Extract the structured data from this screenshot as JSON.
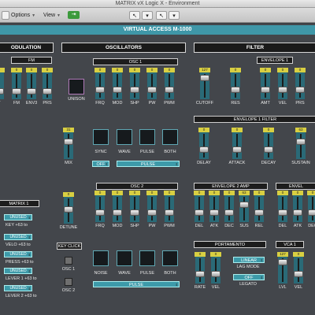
{
  "window": {
    "title": "MATRIX vX Logic X - Environment"
  },
  "toolbar": {
    "options": "Options",
    "view": "View",
    "green_icon": "green-midi-icon"
  },
  "header": {
    "title": "VIRTUAL ACCESS  M-1000"
  },
  "sections": {
    "modulation": "ODULATION",
    "oscillators": "OSCILLATORS",
    "filter": "FILTER"
  },
  "subsections": {
    "fm": "FM",
    "osc1": "OSC 1",
    "osc2": "OSC 2",
    "envelope1": "ENVELOPE 1",
    "envelope1_filter": "ENVELOPE 1 FILTER",
    "envelope2_amp": "ENVELOPE 2 AMP",
    "envelope_partial": "ENVEL",
    "portamento": "PORTAMENTO",
    "vca1": "VCA 1",
    "matrix1": "MATRIX 1",
    "key_click": "KEY CLICK"
  },
  "sliders": {
    "fm_t": {
      "label": "T",
      "value": "0"
    },
    "fm_fm": {
      "label": "FM",
      "value": "0"
    },
    "fm_env3": {
      "label": "ENV3",
      "value": "0"
    },
    "fm_prs": {
      "label": "PRS",
      "value": "0"
    },
    "osc1_frq": {
      "label": "FRQ",
      "value": "0"
    },
    "osc1_mod": {
      "label": "MOD",
      "value": "0"
    },
    "osc1_shp": {
      "label": "SHP",
      "value": "0"
    },
    "osc1_pw": {
      "label": "PW",
      "value": "0"
    },
    "osc1_pwm": {
      "label": "PWM",
      "value": "0"
    },
    "f_cutoff": {
      "label": "CUTOFF",
      "value": "127"
    },
    "f_res": {
      "label": "RES",
      "value": "0"
    },
    "f_amt": {
      "label": "AMT",
      "value": "0"
    },
    "f_vel": {
      "label": "VEL",
      "value": "0"
    },
    "f_prs": {
      "label": "PRS",
      "value": "0"
    },
    "mix": {
      "label": "MIX",
      "value": "31"
    },
    "e1_delay": {
      "label": "DELAY",
      "value": "0"
    },
    "e1_attack": {
      "label": "ATTACK",
      "value": "0"
    },
    "e1_decay": {
      "label": "DECAY",
      "value": "0"
    },
    "e1_sustain": {
      "label": "SUSTAIN",
      "value": "63"
    },
    "detune": {
      "label": "DETUNE",
      "value": "0"
    },
    "osc2_frq": {
      "label": "FRQ",
      "value": "0"
    },
    "osc2_mod": {
      "label": "MOD",
      "value": "0"
    },
    "osc2_shp": {
      "label": "SHP",
      "value": "0"
    },
    "osc2_pw": {
      "label": "PW",
      "value": "0"
    },
    "osc2_pwm": {
      "label": "PWM",
      "value": "0"
    },
    "e2_del": {
      "label": "DEL",
      "value": "0"
    },
    "e2_atk": {
      "label": "ATK",
      "value": "0"
    },
    "e2_dec": {
      "label": "DEC",
      "value": "0"
    },
    "e2_sus": {
      "label": "SUS",
      "value": "63"
    },
    "e2_rel": {
      "label": "REL",
      "value": "0"
    },
    "e3_del": {
      "label": "DEL",
      "value": "0"
    },
    "e3_atk": {
      "label": "ATK",
      "value": "0"
    },
    "e3_dec": {
      "label": "DEC",
      "value": "0"
    },
    "p_rate": {
      "label": "RATE",
      "value": "0"
    },
    "p_vel": {
      "label": "VEL",
      "value": "0"
    },
    "vca_lvl": {
      "label": "LVL",
      "value": "127"
    },
    "vca_vel": {
      "label": "VEL",
      "value": "0"
    }
  },
  "buttons": {
    "unison": "UNISON",
    "sync": "SYNC",
    "wave": "WAVE",
    "pulse": "PULSE",
    "both": "BOTH",
    "noise": "NOISE",
    "wave2": "WAVE",
    "pulse2": "PULSE",
    "both2": "BOTH",
    "osc1": "OSC 1",
    "osc2": "OSC 2"
  },
  "selects": {
    "sync_mode": "OFF",
    "osc1_wave": "PULSE",
    "osc2_wave": "PULSE",
    "lag_source": "LINEAR",
    "lag_mode_label": "LAG MODE",
    "legato_value": "OFF",
    "legato_label": "LEGATO"
  },
  "matrix": {
    "rows": [
      {
        "value": "UNUSED",
        "text": "KEY +63 to"
      },
      {
        "value": "UNUSED",
        "text": "VELO +63 to"
      },
      {
        "value": "UNUSED",
        "text": "PRESS +63 to"
      },
      {
        "value": "UNUSED",
        "text": "LEVER 1 +63 to"
      },
      {
        "value": "UNUSED",
        "text": "LEVER 2 +63 to"
      }
    ]
  }
}
